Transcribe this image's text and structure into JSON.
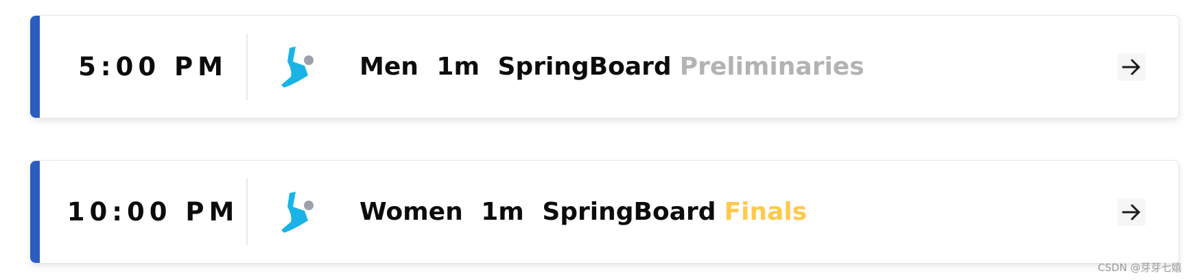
{
  "colors": {
    "accent": "#2b5cbf",
    "icon_blue": "#1ab3e6",
    "icon_dot": "#9aa1ac",
    "preliminaries": "#b3b3b3",
    "finals": "#ffc94d"
  },
  "events": [
    {
      "time": "5:00 PM",
      "sport_icon": "diving-icon",
      "event_name": "Men 1m SpringBoard",
      "stage": "Preliminaries",
      "stage_color": "#b3b3b3"
    },
    {
      "time": "10:00 PM",
      "sport_icon": "diving-icon",
      "event_name": "Women 1m SpringBoard",
      "stage": "Finals",
      "stage_color": "#ffc94d"
    }
  ],
  "watermark": "CSDN @芽芽七嬉"
}
